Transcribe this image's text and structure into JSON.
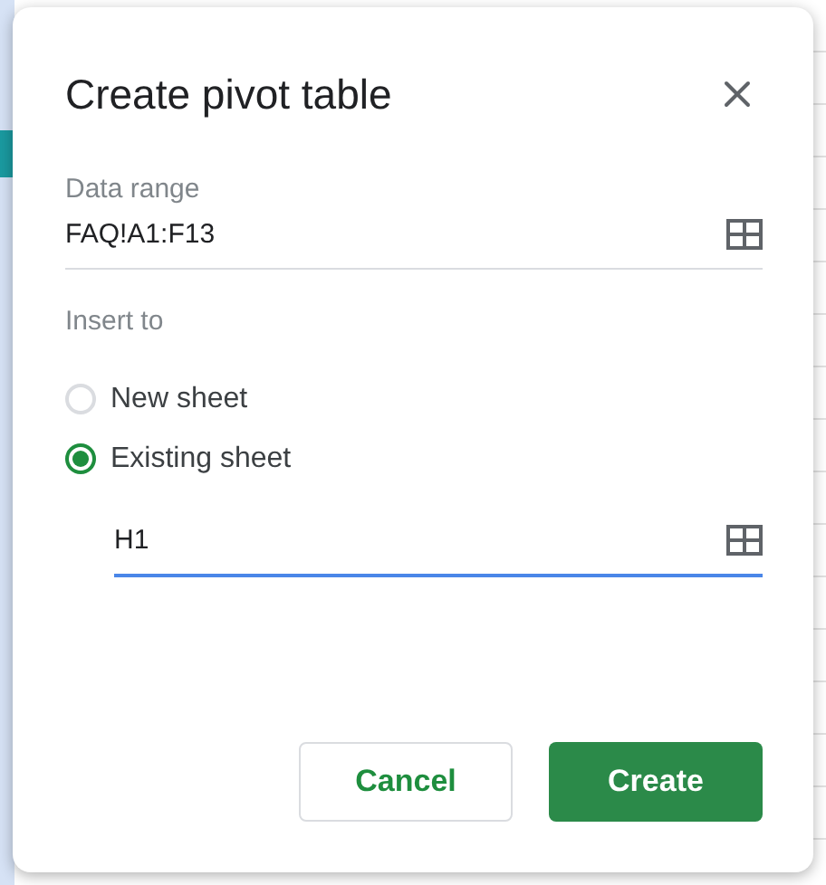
{
  "dialog": {
    "title": "Create pivot table",
    "data_range": {
      "label": "Data range",
      "value": "FAQ!A1:F13",
      "focused": false
    },
    "insert_to": {
      "label": "Insert to",
      "options": [
        {
          "label": "New sheet",
          "selected": false
        },
        {
          "label": "Existing sheet",
          "selected": true
        }
      ]
    },
    "location": {
      "value": "H1",
      "focused": true
    },
    "buttons": [
      {
        "label": "Cancel",
        "kind": "secondary"
      },
      {
        "label": "Create",
        "kind": "primary"
      }
    ]
  }
}
